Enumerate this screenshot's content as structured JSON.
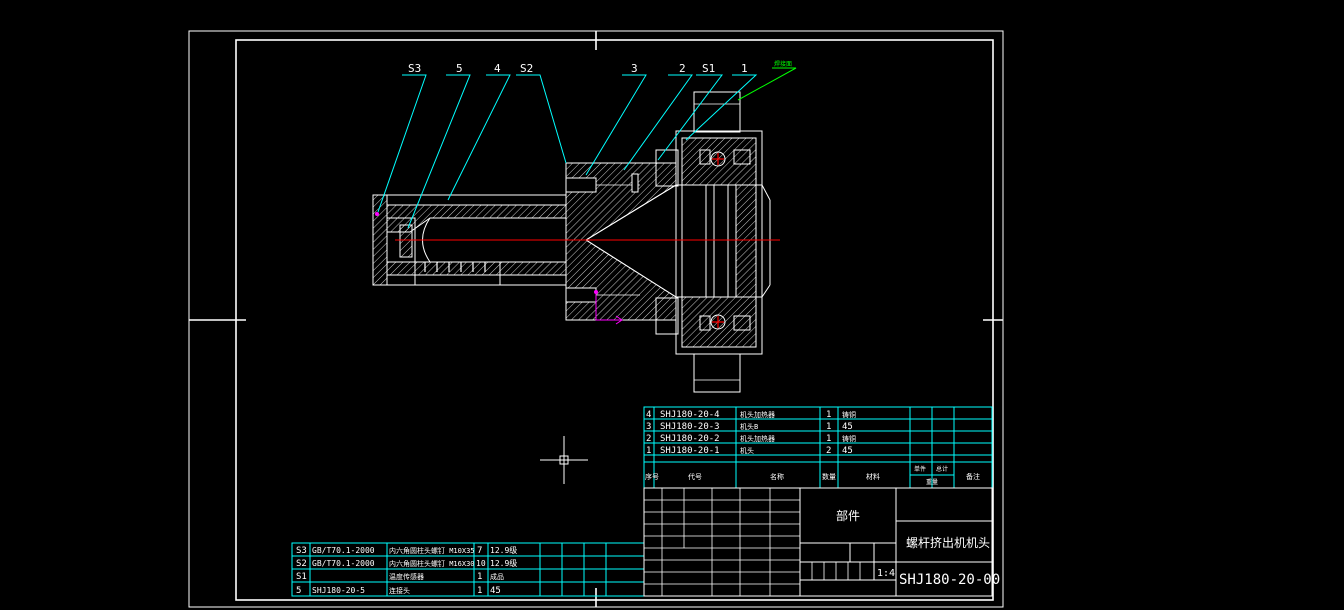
{
  "drawing": {
    "title": "螺杆挤出机机头",
    "drawing_number": "SHJ180-20-00",
    "scale": "1:4",
    "assembly_label": "部件",
    "note_label": "焊接面"
  },
  "callouts": [
    "S3",
    "5",
    "4",
    "S2",
    "3",
    "2",
    "S1",
    "1"
  ],
  "bom_header": {
    "seq": "序号",
    "code": "代号",
    "name": "名称",
    "qty": "数量",
    "material": "材料",
    "unit_weight": "单件",
    "total_weight": "总计",
    "weight": "重量",
    "remark": "备注"
  },
  "parts_list": [
    {
      "seq": "4",
      "code": "SHJ180-20-4",
      "name": "机头加热器",
      "qty": "1",
      "material": "铸铜"
    },
    {
      "seq": "3",
      "code": "SHJ180-20-3",
      "name": "机头B",
      "qty": "1",
      "material": "45"
    },
    {
      "seq": "2",
      "code": "SHJ180-20-2",
      "name": "机头加热器",
      "qty": "1",
      "material": "铸铜"
    },
    {
      "seq": "1",
      "code": "SHJ180-20-1",
      "name": "机头",
      "qty": "2",
      "material": "45"
    }
  ],
  "standard_parts": [
    {
      "seq": "S3",
      "code": "GB/T70.1-2000",
      "name": "内六角圆柱头螺钉 M10X35",
      "qty": "7",
      "material": "12.9级"
    },
    {
      "seq": "S2",
      "code": "GB/T70.1-2000",
      "name": "内六角圆柱头螺钉 M16X30",
      "qty": "10",
      "material": "12.9级"
    },
    {
      "seq": "S1",
      "code": "",
      "name": "温度传感器",
      "qty": "1",
      "material": "成品"
    },
    {
      "seq": "5",
      "code": "SHJ180-20-5",
      "name": "连接头",
      "qty": "1",
      "material": "45"
    }
  ],
  "colors": {
    "frame": "#ffffff",
    "table": "#00ffff",
    "leader": "#00ffff",
    "center": "#ff0000",
    "bolt": "#ff00ff",
    "note": "#00ff00"
  }
}
